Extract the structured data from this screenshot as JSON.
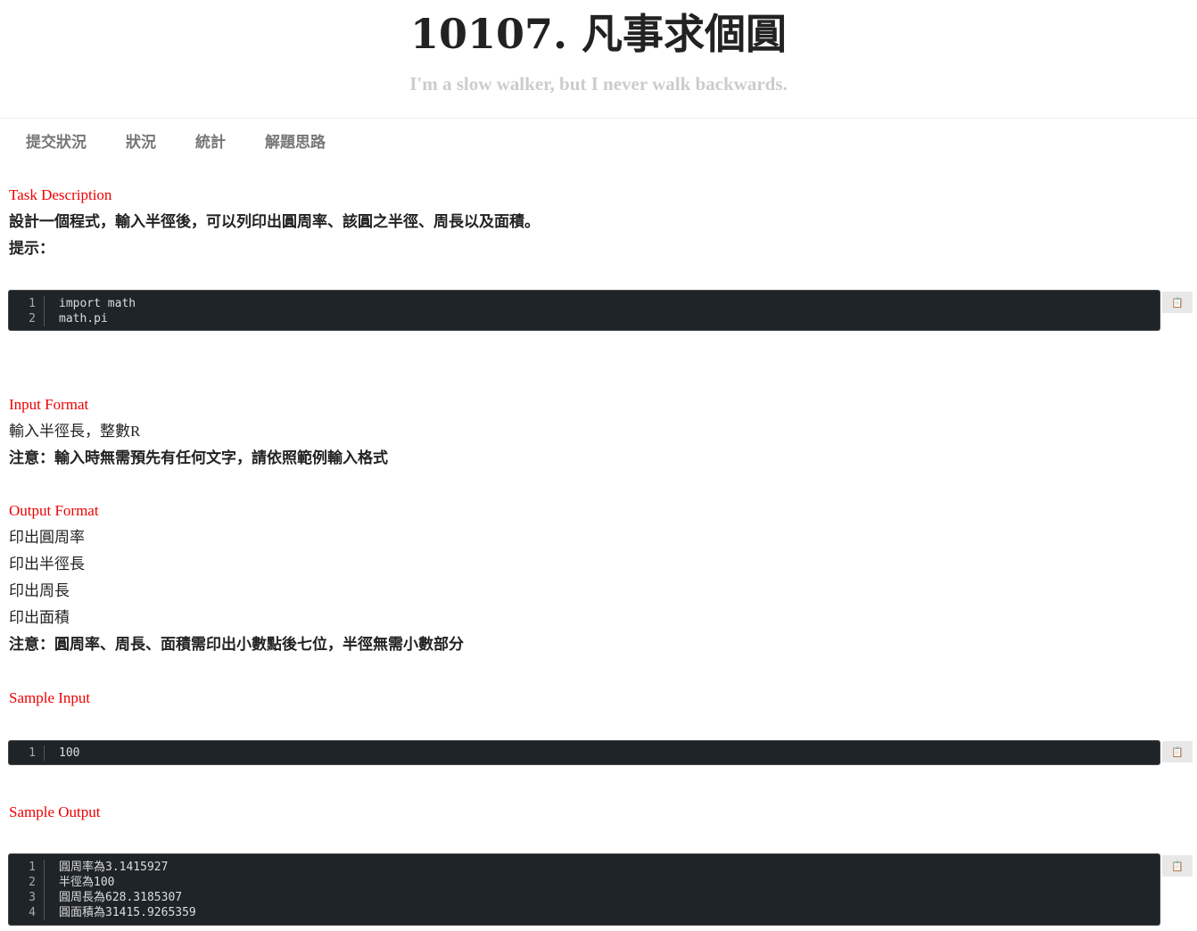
{
  "header": {
    "title": "10107. 凡事求個圓",
    "subtitle": "I'm a slow walker, but I never walk backwards."
  },
  "nav": [
    "提交狀況",
    "狀況",
    "統計",
    "解題思路"
  ],
  "task": {
    "heading": "Task Description",
    "lines": [
      "設計一個程式，輸入半徑後，可以列印出圓周率、該圓之半徑、周長以及面積。",
      "提示："
    ],
    "code": [
      "import math",
      "math.pi"
    ]
  },
  "input": {
    "heading": "Input Format",
    "lines": [
      "輸入半徑長，整數R",
      "注意：輸入時無需預先有任何文字，請依照範例輸入格式"
    ]
  },
  "output": {
    "heading": "Output Format",
    "lines": [
      "印出圓周率",
      "印出半徑長",
      "印出周長",
      "印出面積",
      "注意：圓周率、周長、面積需印出小數點後七位，半徑無需小數部分"
    ]
  },
  "sample_input": {
    "heading": "Sample Input",
    "code": [
      "100"
    ]
  },
  "sample_output": {
    "heading": "Sample Output",
    "code": [
      "圓周率為3.1415927",
      "半徑為100",
      "圓周長為628.3185307",
      "圓面積為31415.9265359"
    ]
  },
  "copy_icon": "clipboard-icon"
}
